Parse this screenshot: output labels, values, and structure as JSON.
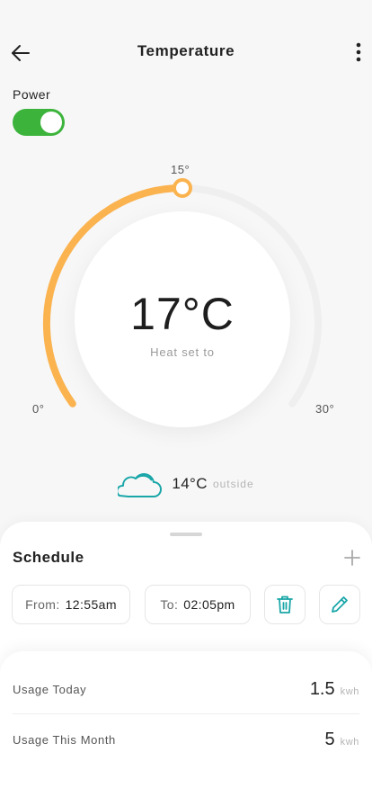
{
  "header": {
    "title": "Temperature",
    "back_icon": "arrow-left-icon",
    "menu_icon": "more-vertical-icon"
  },
  "power": {
    "label": "Power",
    "on": true,
    "color": "#3cb43c"
  },
  "dial": {
    "value_text": "17°C",
    "subtitle": "Heat set to",
    "min_label": "0°",
    "max_label": "30°",
    "marker_label": "15°",
    "min": 0,
    "max": 30,
    "setpoint": 15,
    "accent_color": "#fbb34f",
    "track_color": "#efefef"
  },
  "outside": {
    "icon": "cloud-icon",
    "temp": "14°C",
    "label": "outside",
    "icon_color": "#1aa6a8"
  },
  "schedule": {
    "title": "Schedule",
    "add_icon": "plus-icon",
    "from_label": "From:",
    "from_value": "12:55am",
    "to_label": "To:",
    "to_value": "02:05pm",
    "delete_icon": "trash-icon",
    "edit_icon": "pencil-icon",
    "icon_color": "#1aa6a8"
  },
  "usage": {
    "rows": [
      {
        "name": "Usage Today",
        "value": "1.5",
        "unit": "kwh"
      },
      {
        "name": "Usage This Month",
        "value": "5",
        "unit": "kwh"
      }
    ]
  }
}
